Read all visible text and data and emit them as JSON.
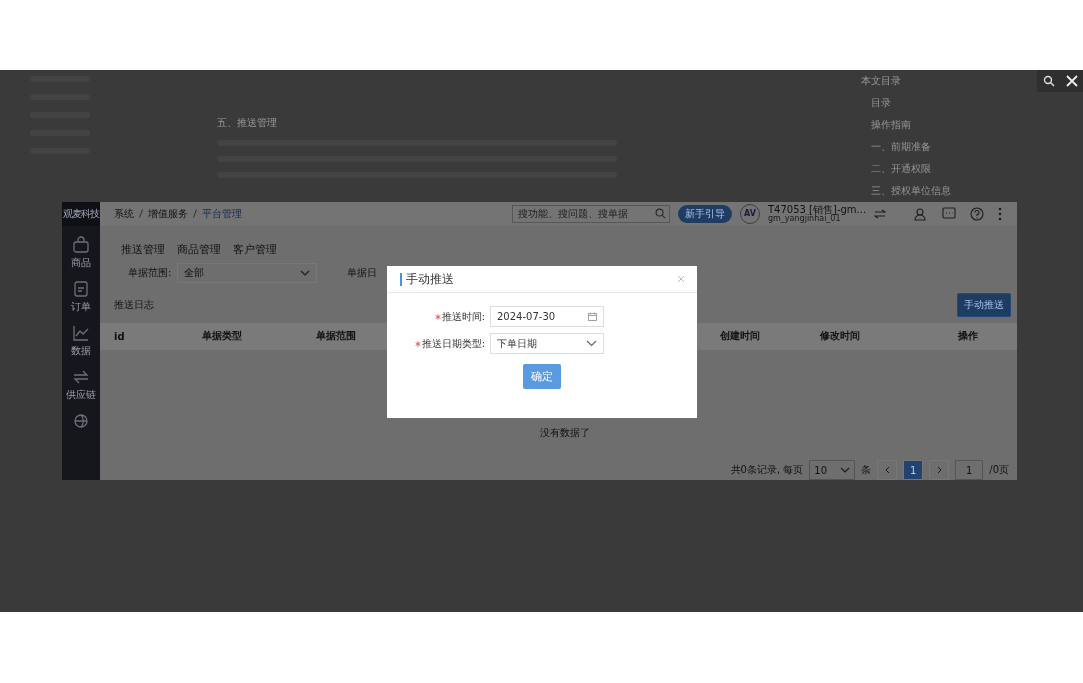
{
  "viewer": {
    "doc_heading": "五、推送管理",
    "toc_title": "本文目录",
    "toc_items": [
      "目录",
      "操作指南",
      "一、前期准备",
      "二、开通权限",
      "三、授权单位信息"
    ]
  },
  "app": {
    "logo": "观麦科技",
    "nav": [
      {
        "kind": "bag",
        "label": "商品"
      },
      {
        "kind": "doc",
        "label": "订单"
      },
      {
        "kind": "chart",
        "label": "数据"
      },
      {
        "kind": "swap",
        "label": "供应链"
      },
      {
        "kind": "globe"
      }
    ],
    "breadcrumb": [
      "系统",
      "增值服务",
      "平台管理"
    ],
    "search": {
      "placeholder": "搜功能、搜问题、搜单据"
    },
    "guide_button": "新手引导",
    "avatar": "AV",
    "user_name": "T47053 [销售]-gm...",
    "user_id": "gm_yangjinhai_01",
    "tabs": [
      "推送管理",
      "商品管理",
      "客户管理"
    ],
    "filters": [
      {
        "label": "单据范围:",
        "value": "全部"
      },
      {
        "label": "单据日"
      }
    ],
    "log_title": "推送日志",
    "push_button": "手动推送",
    "columns": [
      "id",
      "单据类型",
      "单据范围",
      "创建时间",
      "修改时间",
      "操作"
    ],
    "empty": "没有数据了",
    "pagination": {
      "summary": "共0条记录, 每页",
      "page_size": "10",
      "unit": "条",
      "pages": [
        {
          "label": "1",
          "selected": true
        }
      ],
      "jump": "1",
      "total": "/0页"
    }
  },
  "modal": {
    "title": "手动推送",
    "fields": [
      {
        "kind": "date",
        "label": "推送时间:",
        "required": true,
        "value": "2024-07-30"
      },
      {
        "kind": "select",
        "label": "推送日期类型:",
        "required": true,
        "value": "下单日期"
      }
    ],
    "confirm": "确定"
  }
}
